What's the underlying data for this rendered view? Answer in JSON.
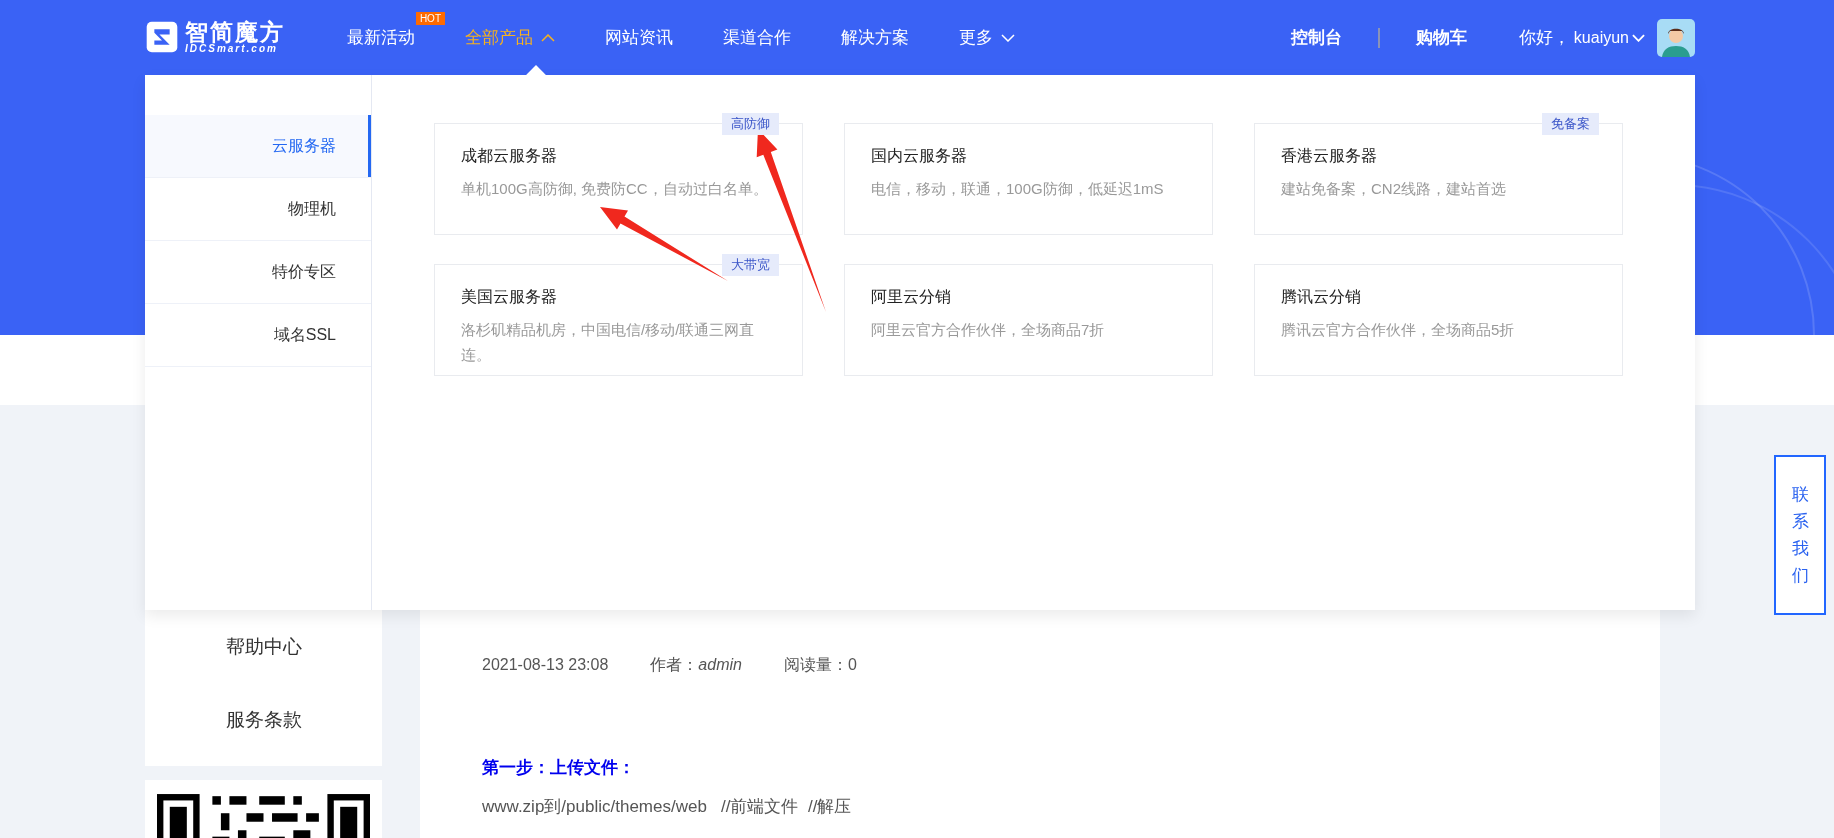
{
  "header": {
    "logo": {
      "name": "智简魔方",
      "domain": "IDCSmart.com"
    },
    "nav": [
      {
        "label": "最新活动",
        "selected": false,
        "badge": "HOT"
      },
      {
        "label": "全部产品",
        "selected": true,
        "expanded": true
      },
      {
        "label": "网站资讯",
        "selected": false
      },
      {
        "label": "渠道合作",
        "selected": false
      },
      {
        "label": "解决方案",
        "selected": false
      },
      {
        "label": "更多",
        "selected": false,
        "expanded": false
      }
    ],
    "links": [
      "控制台",
      "购物车"
    ],
    "greeting": "你好，",
    "username": "kuaiyun"
  },
  "product_menu": {
    "categories": [
      {
        "label": "云服务器",
        "selected": true
      },
      {
        "label": "物理机",
        "selected": false
      },
      {
        "label": "特价专区",
        "selected": false
      },
      {
        "label": "域名SSL",
        "selected": false
      }
    ],
    "cards": [
      {
        "title": "成都云服务器",
        "desc": "单机100G高防御, 免费防CC，自动过白名单。",
        "tag": "高防御"
      },
      {
        "title": "国内云服务器",
        "desc": "电信，移动，联通，100G防御，低延迟1mS"
      },
      {
        "title": "香港云服务器",
        "desc": "建站免备案，CN2线路，建站首选",
        "tag": "免备案"
      },
      {
        "title": "美国云服务器",
        "desc": "洛杉矶精品机房，中国电信/移动/联通三网直连。",
        "tag": "大带宽"
      },
      {
        "title": "阿里云分销",
        "desc": "阿里云官方合作伙伴，全场商品7折"
      },
      {
        "title": "腾讯云分销",
        "desc": "腾讯云官方合作伙伴，全场商品5折"
      }
    ]
  },
  "sidebar": {
    "items": [
      "帮助中心",
      "服务条款"
    ]
  },
  "article": {
    "date": "2021-08-13 23:08",
    "author_label": "作者：",
    "author": "admin",
    "views": "阅读量：0",
    "step_heading": "第一步：上传文件：",
    "step_text": "www.zip到/public/themes/web   //前端文件  //解压"
  },
  "contact": {
    "label": "联系我们"
  }
}
